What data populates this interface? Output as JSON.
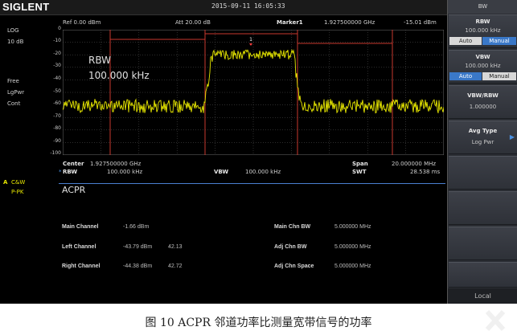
{
  "header": {
    "logo": "SIGLENT",
    "datetime": "2015-09-11  16:05:33",
    "ref": "Ref  0.00 dBm",
    "att": "Att  20.00 dB",
    "marker_label": "Marker1",
    "marker_freq": "1.927500000  GHz",
    "marker_level": "-15.01 dBm"
  },
  "left_panel": {
    "scale_type": "LOG",
    "scale_div": "10 dB",
    "trace_mode1": "Free",
    "trace_mode2": "LgPwr",
    "trace_mode3": "Cont",
    "trace_a": "A",
    "trace_a_mode": "C&W",
    "trace_detector": "P-PK"
  },
  "plot": {
    "y_ticks": [
      "0",
      "-10",
      "-20",
      "-30",
      "-40",
      "-50",
      "-60",
      "-70",
      "-80",
      "-90",
      "-100"
    ],
    "marker_number": "1",
    "rbw_overlay_label": "RBW",
    "rbw_overlay_value": "100.000  kHz"
  },
  "footer": {
    "center_label": "Center",
    "center_value": "1.927500000  GHz",
    "span_label": "Span",
    "span_value": "20.000000  MHz",
    "rbw_label": "RBW",
    "rbw_value": "100.000  kHz",
    "vbw_label": "VBW",
    "vbw_value": "100.000  kHz",
    "swt_label": "SWT",
    "swt_value": "28.538 ms"
  },
  "acpr": {
    "title": "ACPR",
    "main_channel_label": "Main Channel",
    "main_channel_value": "-1.66 dBm",
    "left_channel_label": "Left Channel",
    "left_channel_value": "-43.79 dBm",
    "left_channel_ratio": "42.13",
    "right_channel_label": "Right Channel",
    "right_channel_value": "-44.38 dBm",
    "right_channel_ratio": "42.72",
    "main_chn_bw_label": "Main Chn BW",
    "main_chn_bw_value": "5.000000  MHz",
    "adj_chn_bw_label": "Adj Chn BW",
    "adj_chn_bw_value": "5.000000  MHz",
    "adj_chn_space_label": "Adj Chn Space",
    "adj_chn_space_value": "5.000000  MHz"
  },
  "softkeys": {
    "title": "BW",
    "rbw_title": "RBW",
    "rbw_value": "100.000  kHz",
    "rbw_auto": "Auto",
    "rbw_manual": "Manual",
    "vbw_title": "VBW",
    "vbw_value": "100.000  kHz",
    "vbw_auto": "Auto",
    "vbw_manual": "Manual",
    "ratio_title": "VBW/RBW",
    "ratio_value": "1.000000",
    "avg_title": "Avg Type",
    "avg_value": "Log Pwr",
    "local": "Local"
  },
  "caption": "图 10 ACPR 邻道功率比测量宽带信号的功率",
  "colors": {
    "trace": "#e8e800",
    "grid": "#5a5a5a",
    "channel_lines": "#c8382e",
    "accent": "#3a78c8"
  }
}
